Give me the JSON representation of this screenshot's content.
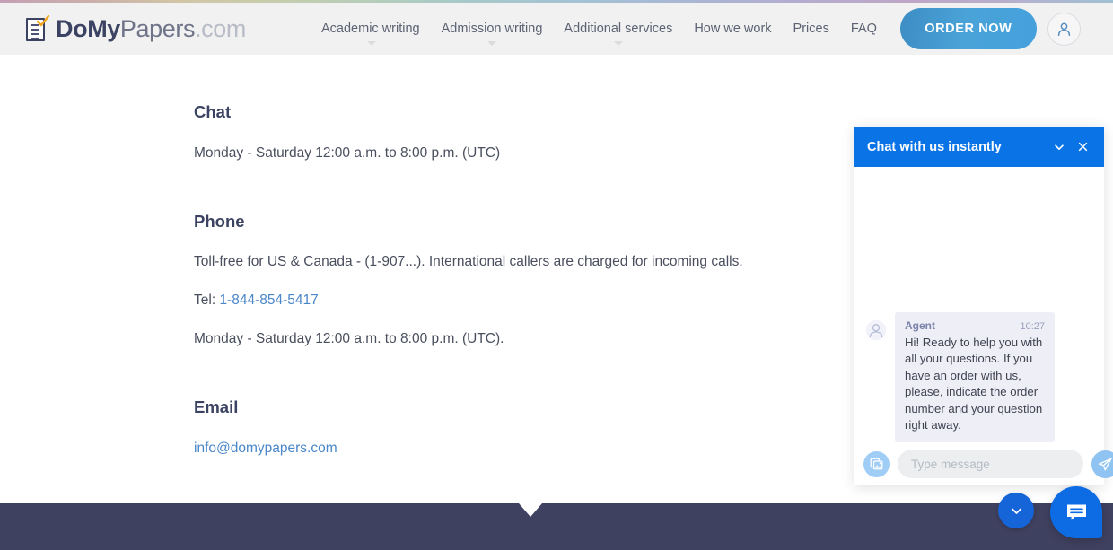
{
  "header": {
    "logo": {
      "part1": "Do",
      "part2": "My",
      "part3": "Papers",
      "part4": ".com"
    },
    "nav": [
      {
        "label": "Academic writing",
        "has_dropdown": true
      },
      {
        "label": "Admission writing",
        "has_dropdown": true
      },
      {
        "label": "Additional services",
        "has_dropdown": true
      },
      {
        "label": "How we work",
        "has_dropdown": false
      },
      {
        "label": "Prices",
        "has_dropdown": false
      },
      {
        "label": "FAQ",
        "has_dropdown": false
      }
    ],
    "order_button": "ORDER NOW",
    "account_icon": "user-icon"
  },
  "main": {
    "sections": [
      {
        "title": "Chat",
        "lines": [
          "Monday - Saturday 12:00 a.m. to 8:00 p.m. (UTC)"
        ]
      },
      {
        "title": "Phone",
        "lines": [
          "Toll-free for US & Canada - (1-907...). International callers are charged for incoming calls.",
          "Tel: ",
          "Monday - Saturday 12:00 a.m. to 8:00 p.m. (UTC)."
        ],
        "phone_link": "1-844-854-5417"
      },
      {
        "title": "Email",
        "email_link": "info@domypapers.com"
      }
    ]
  },
  "chat_widget": {
    "title": "Chat with us instantly",
    "collapse_icon": "chevron-down-icon",
    "close_icon": "close-icon",
    "messages": [
      {
        "sender": "Agent",
        "time": "10:27",
        "text": "Hi! Ready to help you with all your questions. If you have an order with us, please, indicate the order number and your question right away."
      }
    ],
    "input_placeholder": "Type message",
    "input_value": "",
    "attach_icon": "image-attachment-icon",
    "send_icon": "send-paper-plane-icon"
  },
  "floating": {
    "minimize_icon": "chevron-down-icon",
    "chat_icon": "chat-bubble-icon"
  },
  "colors": {
    "header_bg": "#f1f1f2",
    "brand_dark": "#3c4362",
    "chat_blue": "#0a74e6",
    "order_blue": "#45a0dd",
    "link_blue": "#4a86c8",
    "footer_navy": "#3f4160"
  }
}
